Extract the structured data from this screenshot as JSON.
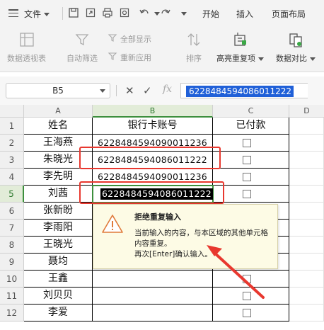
{
  "menu": {
    "file_label": "文件",
    "tabs": [
      "开始",
      "插入",
      "页面布局"
    ]
  },
  "ribbon": {
    "pivot_label": "数据透视表",
    "autofilter_label": "自动筛选",
    "show_all_label": "全部显示",
    "reapply_label": "重新应用",
    "sort_label": "排序",
    "highlight_dup_label": "高亮重复项",
    "data_compare_label": "数据对比"
  },
  "formula_bar": {
    "name_box": "B5",
    "fx_label": "fx",
    "value": "6228484594086011222"
  },
  "sheet": {
    "columns": [
      "A",
      "B",
      "C",
      "D"
    ],
    "rows": [
      "1",
      "2",
      "3",
      "4",
      "5",
      "6",
      "7",
      "8",
      "9",
      "10",
      "11",
      "12"
    ],
    "header": {
      "name": "姓名",
      "card": "银行卡账号",
      "paid": "已付款"
    },
    "names": [
      "王海燕",
      "朱晓光",
      "李先明",
      "刘茜",
      "张新盼",
      "李雨阳",
      "王晓光",
      "聂均",
      "王鑫",
      "刘贝贝",
      "李爱"
    ],
    "cards": [
      "6228484594090011236",
      "6228484594086011222",
      "6228484594090011236",
      "6228484594086011222"
    ]
  },
  "tooltip": {
    "title": "拒绝重复输入",
    "line1": "当前输入的内容，与本区域的其他单元格内容重复。",
    "line2": "再次[Enter]确认输入。"
  },
  "colors": {
    "accent_green": "#3d8f3d",
    "highlight_red": "#e8382f",
    "selection_blue": "#2060d8"
  }
}
